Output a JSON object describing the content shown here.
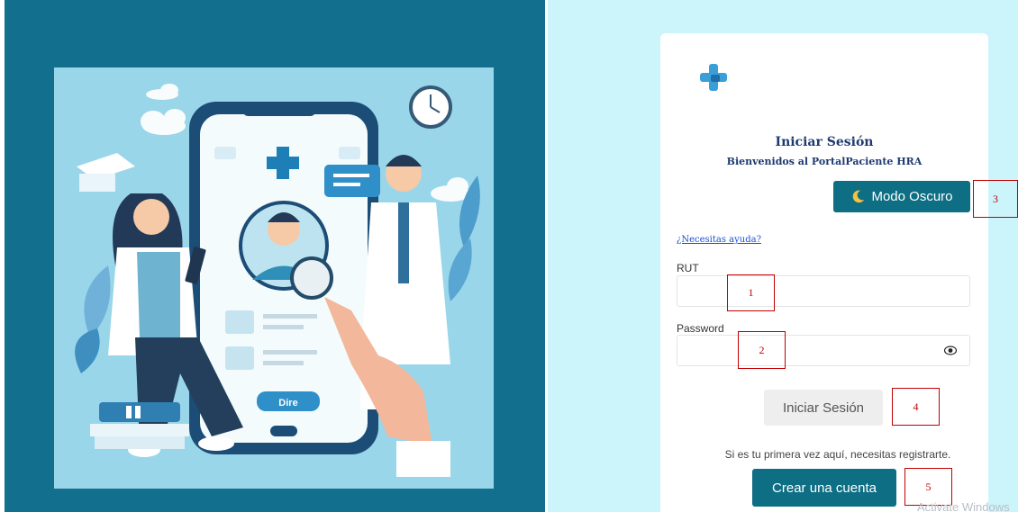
{
  "login": {
    "title": "Iniciar Sesión",
    "subtitle": "Bienvenidos al PortalPaciente HRA",
    "dark_mode_label": "Modo Oscuro",
    "help_link": "¿Necesitas ayuda?",
    "rut_label": "RUT",
    "rut_value": "",
    "password_label": "Password",
    "password_value": "",
    "login_button": "Iniciar Sesión",
    "register_prompt": "Si es tu primera vez aquí, necesitas registrarte.",
    "create_account_button": "Crear una cuenta"
  },
  "hero": {
    "app_button_label": "Dire"
  },
  "annotations": [
    "1",
    "2",
    "3",
    "4",
    "5"
  ],
  "watermark": "Activate Windows",
  "colors": {
    "left_panel": "#126f8e",
    "right_panel": "#ccf5fb",
    "primary_button": "#0d6e84",
    "title_text": "#1d3a70",
    "annotation": "#c00000"
  }
}
